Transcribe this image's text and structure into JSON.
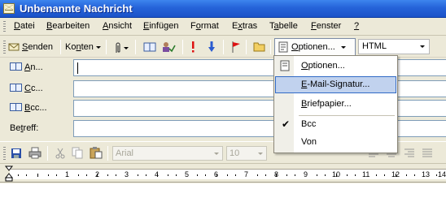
{
  "window": {
    "title": "Unbenannte Nachricht"
  },
  "menu": {
    "items": [
      {
        "pre": "",
        "u": "D",
        "post": "atei"
      },
      {
        "pre": "",
        "u": "B",
        "post": "earbeiten"
      },
      {
        "pre": "",
        "u": "A",
        "post": "nsicht"
      },
      {
        "pre": "",
        "u": "E",
        "post": "infügen"
      },
      {
        "pre": "F",
        "u": "o",
        "post": "rmat"
      },
      {
        "pre": "E",
        "u": "x",
        "post": "tras"
      },
      {
        "pre": "T",
        "u": "a",
        "post": "belle"
      },
      {
        "pre": "",
        "u": "F",
        "post": "enster"
      },
      {
        "pre": "",
        "u": "?",
        "post": ""
      }
    ]
  },
  "toolbar": {
    "send_pre": "",
    "send_u": "S",
    "send_post": "enden",
    "accounts_pre": "Ko",
    "accounts_u": "n",
    "accounts_post": "ten",
    "options_pre": "",
    "options_u": "O",
    "options_post": "ptionen...",
    "format_value": "HTML"
  },
  "fields": {
    "to_label_pre": "",
    "to_label_u": "A",
    "to_label_post": "n...",
    "cc_label_pre": "",
    "cc_label_u": "C",
    "cc_label_post": "c...",
    "bcc_label_pre": "",
    "bcc_label_u": "B",
    "bcc_label_post": "cc...",
    "subject_label_pre": "Be",
    "subject_label_u": "t",
    "subject_label_post": "reff:",
    "to_value": "",
    "cc_value": "",
    "bcc_value": "",
    "subject_value": ""
  },
  "formatting": {
    "font": "Arial",
    "size": "10"
  },
  "ruler": {
    "numbers": [
      "1",
      "2",
      "3",
      "4",
      "5",
      "6",
      "7",
      "8",
      "9",
      "10",
      "11",
      "12",
      "13",
      "14"
    ]
  },
  "options_menu": {
    "items": [
      {
        "pre": "",
        "u": "O",
        "post": "ptionen...",
        "checked": false,
        "highlighted": false
      },
      {
        "pre": "",
        "u": "E",
        "post": "-Mail-Signatur...",
        "checked": false,
        "highlighted": true
      },
      {
        "pre": "",
        "u": "B",
        "post": "riefpapier...",
        "checked": false,
        "highlighted": false
      },
      {
        "pre": "Bcc",
        "u": "",
        "post": "",
        "checked": true,
        "highlighted": false
      },
      {
        "pre": "Von",
        "u": "",
        "post": "",
        "checked": false,
        "highlighted": false
      }
    ]
  },
  "colors": {
    "titlebar": "#2563d9",
    "highlight": "#c1d2ee",
    "chrome": "#ece9d8"
  }
}
